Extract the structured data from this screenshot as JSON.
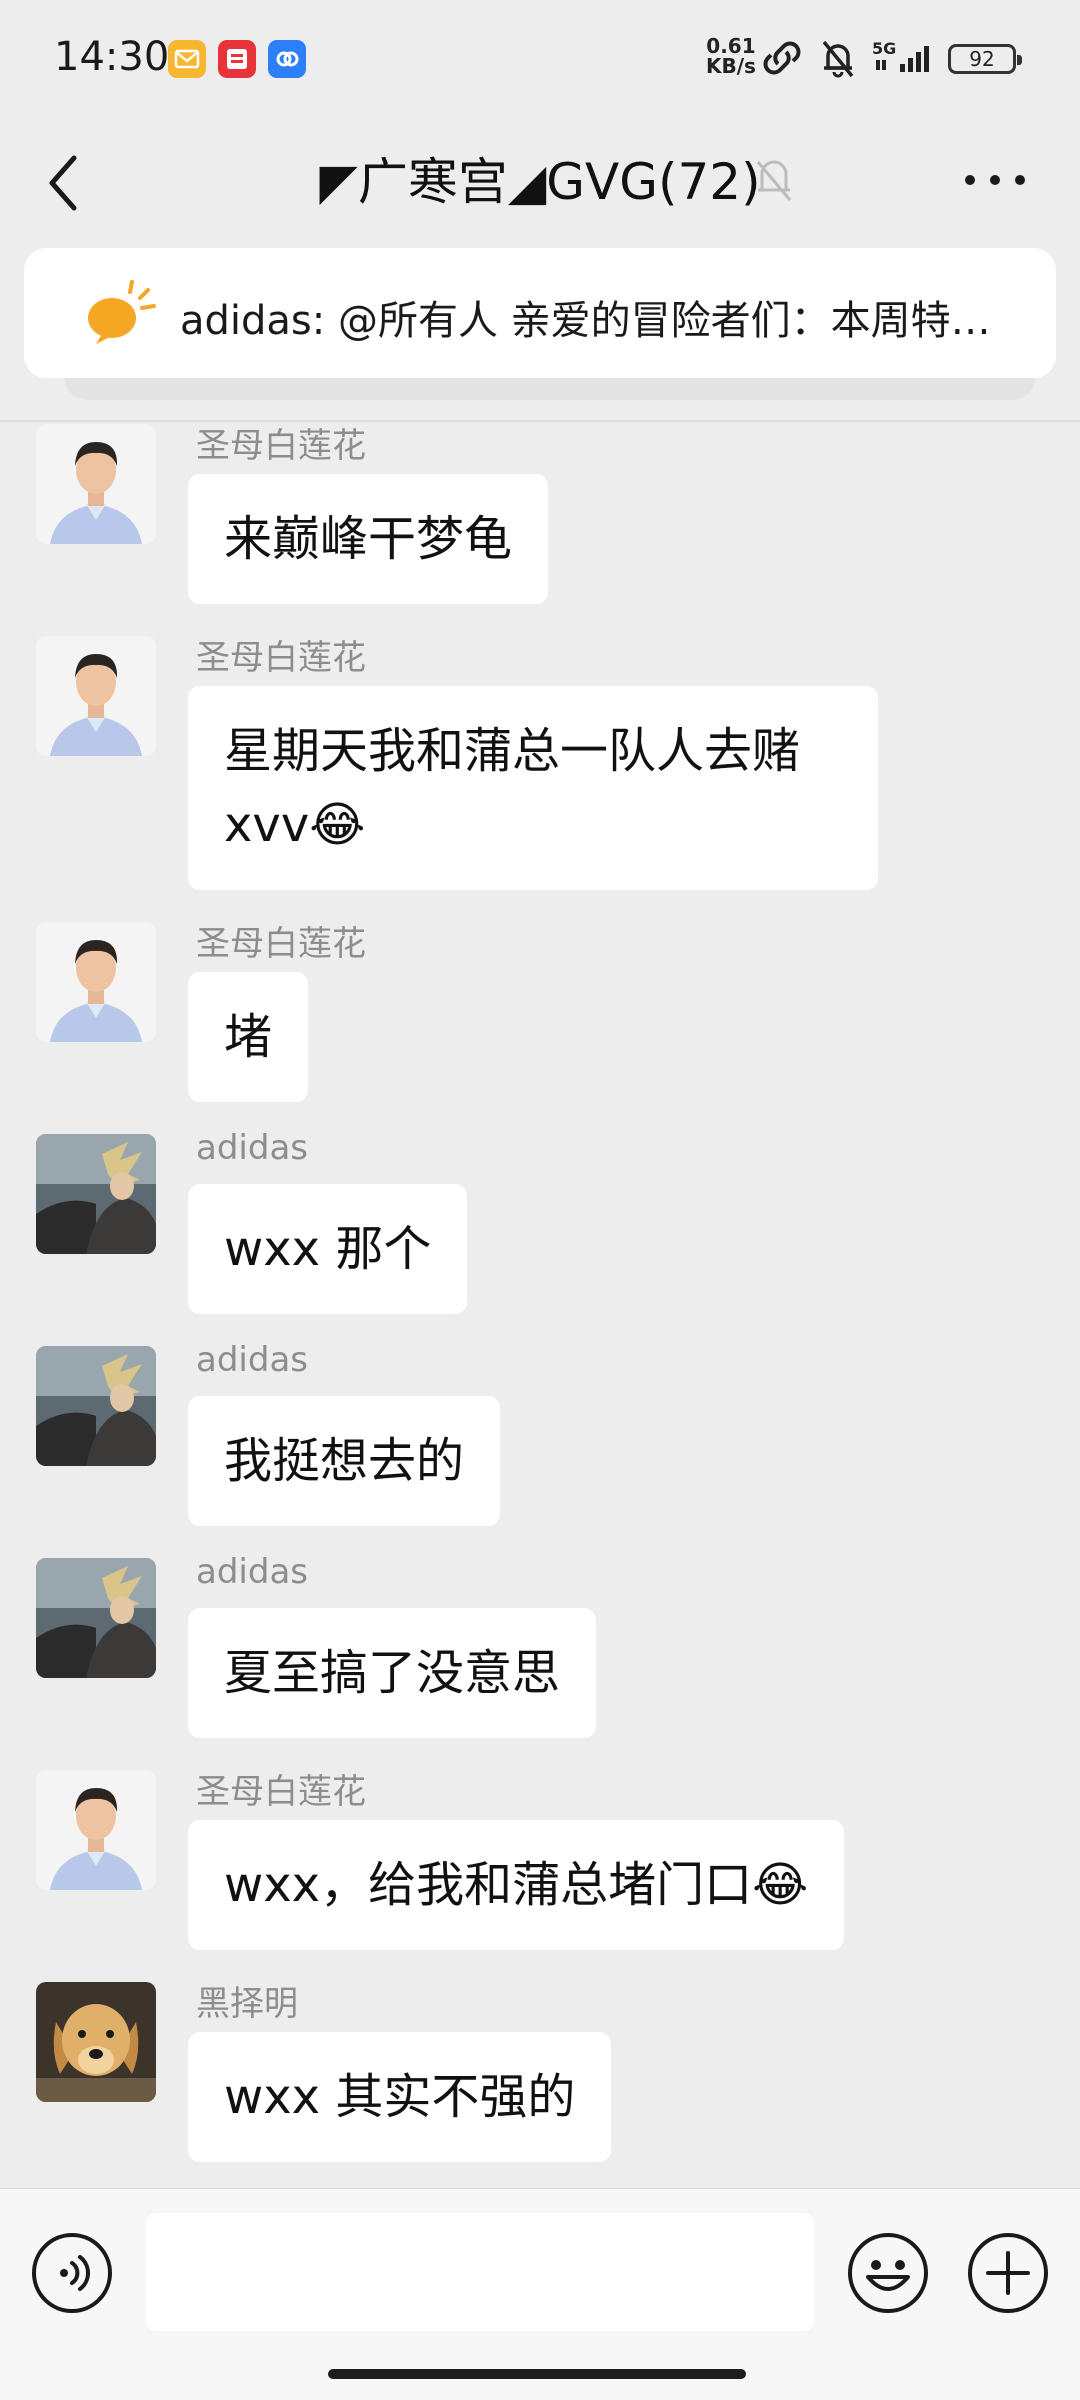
{
  "status_bar": {
    "time": "14:30",
    "net_speed_value": "0.61",
    "net_speed_unit": "KB/s",
    "signal_label": "5G",
    "battery": "92",
    "app_icons": [
      "mail-app-icon",
      "shopping-app-icon",
      "link-app-icon"
    ]
  },
  "header": {
    "title": "◤广寒宫◢GVG(72)",
    "back_icon": "chevron-left-icon",
    "mute_icon": "bell-muted-icon",
    "more_icon": "more-dots-icon"
  },
  "announcement": {
    "icon": "megaphone-icon",
    "text": "adidas: @所有人 亲爱的冒险者们：本周特…",
    "color": "#f5a623"
  },
  "messages": [
    {
      "sender": "圣母白莲花",
      "text": "来巅峰干梦龟",
      "avatar": "man-blue-shirt-avatar"
    },
    {
      "sender": "圣母白莲花",
      "text": "星期天我和蒲总一队人去赌",
      "text2": "xvv",
      "emoji": "😂",
      "avatar": "man-blue-shirt-avatar"
    },
    {
      "sender": "圣母白莲花",
      "text": "堵",
      "avatar": "man-blue-shirt-avatar"
    },
    {
      "sender": "adidas",
      "text": "wxx 那个",
      "avatar": "anime-warrior-avatar"
    },
    {
      "sender": "adidas",
      "text": "我挺想去的",
      "avatar": "anime-warrior-avatar"
    },
    {
      "sender": "adidas",
      "text": "夏至搞了没意思",
      "avatar": "anime-warrior-avatar"
    },
    {
      "sender": "圣母白莲花",
      "text": "wxx，给我和蒲总堵门口",
      "emoji": "😂",
      "avatar": "man-blue-shirt-avatar"
    },
    {
      "sender": "黑择明",
      "text": "wxx 其实不强的",
      "avatar": "golden-retriever-avatar"
    }
  ],
  "input_bar": {
    "voice_icon": "voice-icon",
    "emoji_icon": "smiley-icon",
    "plus_icon": "plus-circle-icon",
    "input_value": ""
  },
  "colors": {
    "background": "#ededed",
    "bubble": "#ffffff",
    "sender_name": "#8d8d8d"
  }
}
